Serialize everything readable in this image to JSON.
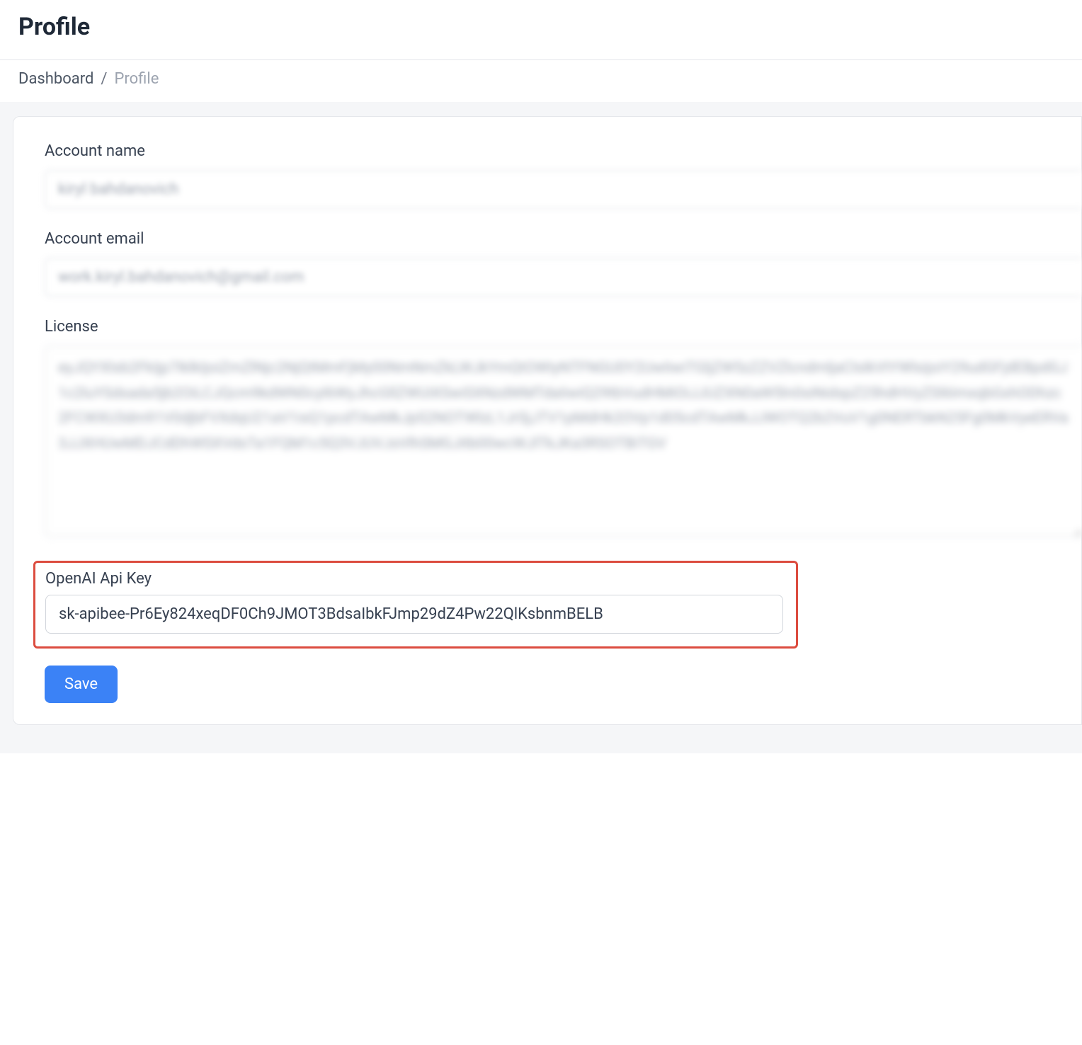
{
  "header": {
    "title": "Profile"
  },
  "breadcrumb": {
    "parent": "Dashboard",
    "separator": "/",
    "current": "Profile"
  },
  "form": {
    "account_name": {
      "label": "Account name",
      "value": "kiryl bahdanovich"
    },
    "account_email": {
      "label": "Account email",
      "value": "work.kiryl.bahdanovich@gmail.com"
    },
    "license": {
      "label": "License",
      "value": "eyJQYXlsb2FkIjp7IklkIjoiZmZlNjc2NjQtMmFjMy00NmNmZkLWJkYmQtOWIyNTFNGU0Y2UwIiwiTGljZW5zZZVZlcndmljaClsIkVtYWlsijoiY29udGFjdEBpdGJ1c2luYSdsada5jb2OiLCJQcm9kdWN0cyl6WyJhcGllZWUiXSwiSXNzdWMTdaIiwiQ29tbVudHMiOiJJUZXN0aW5ln0siNidspZ25hdHVyZSl6ImxqbGxhODhzc2FCWXU3dm91V0djbFVXdqU21aV1isQ1pcdTAwMkJpS2NOTWlzL1JrSjJTV1pMdHk2OVp1d05cdTAwMkJJWOTQ2b2VuV1g0NERTbkN25Fg0MkVyeERVa3JJXHUwMDJCdDhWSXVdsTa1FQM1c5Q3VJUVJsVlhSMGJitb00wcWJlTkJKa3RSOTBiTGV"
    },
    "openai_api_key": {
      "label": "OpenAI Api Key",
      "value": "sk-apibee-Pr6Ey824xeqDF0Ch9JMOT3BdsaIbkFJmp29dZ4Pw22QlKsbnmBELB"
    },
    "save_button_label": "Save"
  }
}
